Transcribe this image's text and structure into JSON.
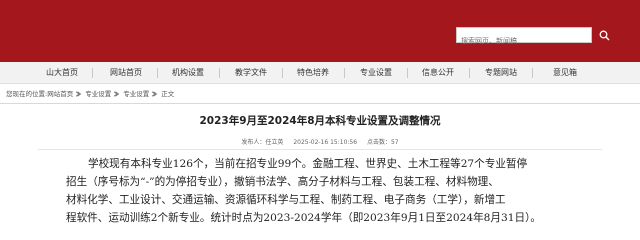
{
  "header": {
    "search_placeholder": "搜索网页、新闻稿",
    "colors": {
      "banner": "#a4171d",
      "nav_bg": "#f2f2f2"
    }
  },
  "nav": {
    "items": [
      "山大首页",
      "网站首页",
      "机构设置",
      "教学文件",
      "特色培养",
      "专业设置",
      "信息公开",
      "专题网站",
      "意见箱"
    ]
  },
  "breadcrumb": {
    "prefix": "您现在的位置:",
    "items": [
      "网站首页",
      "专业设置",
      "专业设置",
      "正文"
    ]
  },
  "article": {
    "title": "2023年9月至2024年8月本科专业设置及调整情况",
    "publisher": "发布人：任立英",
    "date": "2025-02-16 15:10:56",
    "views": "点击数：57",
    "lines": [
      "学校现有本科专业126个，当前在招专业99个。金融工程、世界史、土木工程等27个专业暂停",
      "招生（序号标为“-”的为停招专业），撤销书法学、高分子材料与工程、包装工程、材料物理、",
      "材料化学、工业设计、交通运输、资源循环科学与工程、制药工程、电子商务（工学），新增工",
      "程软件、运动训练2个新专业。统计时点为2023-2024学年（即2023年9月1日至2024年8月31日）。"
    ]
  }
}
